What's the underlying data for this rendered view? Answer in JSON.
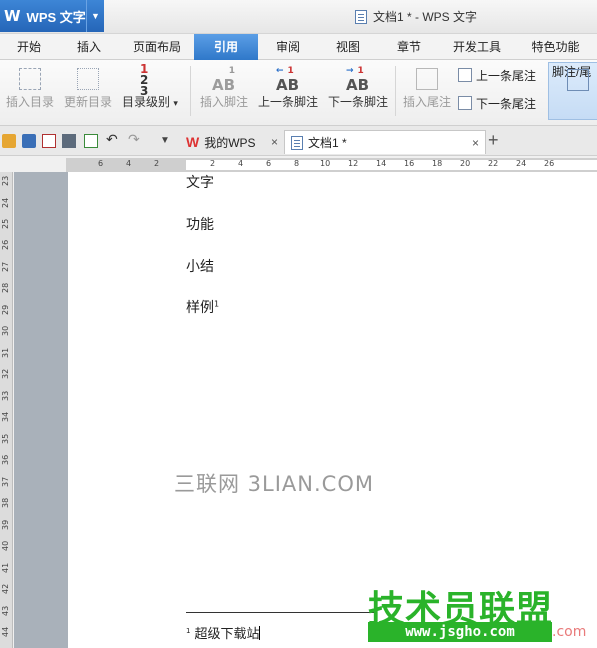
{
  "app": {
    "logo": "W",
    "name": "WPS 文字",
    "window_title": "文档1 * - WPS 文字"
  },
  "tabs": [
    "开始",
    "插入",
    "页面布局",
    "引用",
    "审阅",
    "视图",
    "章节",
    "开发工具",
    "特色功能"
  ],
  "ribbon": {
    "insert_toc": "插入目录",
    "update_toc": "更新目录",
    "toc_level": "目录级别",
    "toc_level_caret": "▾",
    "insert_footnote": "插入脚注",
    "prev_footnote": "上一条脚注",
    "next_footnote": "下一条脚注",
    "insert_endnote": "插入尾注",
    "prev_endnote": "上一条尾注",
    "next_endnote": "下一条尾注",
    "footnote_endnote": "脚注/尾",
    "ab_text": "AB",
    "num_1": "1",
    "num_2": "2",
    "num_3": "3",
    "arrow_left": "←",
    "arrow_right": "→"
  },
  "doc_tabs": {
    "home": "我的WPS",
    "doc": "文档1 *",
    "close": "×",
    "new": "+"
  },
  "ruler": {
    "h_ticks": [
      "6",
      "4",
      "2",
      "2",
      "4",
      "6",
      "8",
      "10",
      "12",
      "14",
      "16",
      "18",
      "20",
      "22",
      "24",
      "26"
    ],
    "v_ticks": [
      "23",
      "24",
      "25",
      "26",
      "27",
      "28",
      "29",
      "30",
      "31",
      "32",
      "33",
      "34",
      "35",
      "36",
      "37",
      "38",
      "39",
      "40",
      "41",
      "42",
      "43",
      "44"
    ]
  },
  "document": {
    "lines": [
      "文字",
      "功能",
      "小结",
      "样例"
    ],
    "footnote_mark": "1",
    "footnote_text": "超级下载站",
    "watermark": "三联网 3LIAN.COM"
  },
  "brand": {
    "name": "技术员联盟",
    "url": "www.jsgho.com",
    "suffix": ".com"
  }
}
